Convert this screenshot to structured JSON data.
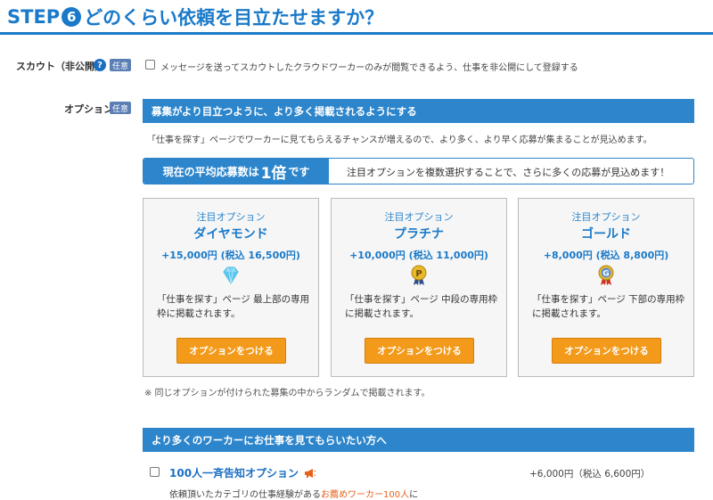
{
  "step": {
    "prefix": "STEP",
    "number": "6",
    "title": "どのくらい依頼を目立たせますか？"
  },
  "scout": {
    "label": "スカウト（非公開）",
    "help_icon": "question-icon",
    "help_glyph": "?",
    "badge": "任意",
    "checkbox_label": "メッセージを送ってスカウトしたクラウドワーカーのみが閲覧できるよう、仕事を非公開にして登録する"
  },
  "option": {
    "label": "オプション",
    "badge": "任意",
    "bar_title": "募集がより目立つように、より多く掲載されるようにする",
    "intro": "「仕事を探す」ページでワーカーに見てもらえるチャンスが増えるので、より多く、より早く応募が集まることが見込めます。",
    "avg": {
      "prefix": "現在の平均応募数は",
      "value": "1倍",
      "suffix": "です",
      "message": "注目オプションを複数選択することで、さらに多くの応募が見込めます！"
    },
    "cards": [
      {
        "subtitle": "注目オプション",
        "name": "ダイヤモンド",
        "price": "+15,000円 (税込 16,500円)",
        "icon": "diamond-icon",
        "desc": "「仕事を探す」ページ 最上部の専用枠に掲載されます。",
        "button": "オプションをつける"
      },
      {
        "subtitle": "注目オプション",
        "name": "プラチナ",
        "price": "+10,000円 (税込 11,000円)",
        "icon": "platinum-medal-icon",
        "icon_letter": "P",
        "desc": "「仕事を探す」ページ 中段の専用枠に掲載されます。",
        "button": "オプションをつける"
      },
      {
        "subtitle": "注目オプション",
        "name": "ゴールド",
        "price": "+8,000円 (税込 8,800円)",
        "icon": "gold-medal-icon",
        "icon_letter": "G",
        "desc": "「仕事を探す」ページ 下部の専用枠に掲載されます。",
        "button": "オプションをつける"
      }
    ],
    "note": "※ 同じオプションが付けられた募集の中からランダムで掲載されます。"
  },
  "more_workers": {
    "bar_title": "より多くのワーカーにお仕事を見てもらいたい方へ",
    "item": {
      "title": "100人一斉告知オプション",
      "icon": "megaphone-icon",
      "price": "+6,000円（税込 6,600円）",
      "desc_prefix": "依頼頂いたカテゴリの仕事経験がある",
      "desc_highlight": "お薦めワーカー100人",
      "desc_suffix": "に"
    }
  },
  "colors": {
    "brand_blue": "#1a7ac9",
    "bar_blue": "#2d86cc",
    "button_orange": "#f39a1a",
    "highlight_orange": "#e8611a"
  }
}
